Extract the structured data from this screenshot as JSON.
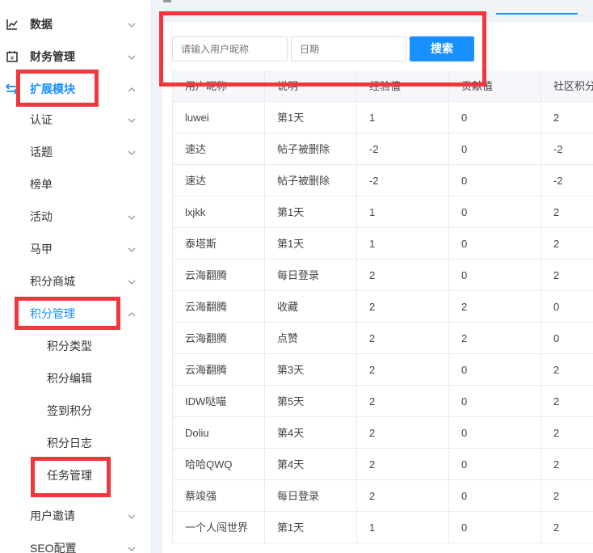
{
  "sidebar": {
    "items": [
      {
        "label": "数据",
        "level": "top",
        "icon": "line-chart-icon",
        "chevron": "down"
      },
      {
        "label": "财务管理",
        "level": "top",
        "icon": "wallet-icon",
        "chevron": "down"
      },
      {
        "label": "扩展模块",
        "level": "top",
        "icon": "extension-icon",
        "chevron": "up",
        "active": true
      },
      {
        "label": "认证",
        "level": "sub",
        "chevron": "down"
      },
      {
        "label": "话题",
        "level": "sub",
        "chevron": "down"
      },
      {
        "label": "榜单",
        "level": "sub"
      },
      {
        "label": "活动",
        "level": "sub",
        "chevron": "down"
      },
      {
        "label": "马甲",
        "level": "sub",
        "chevron": "down"
      },
      {
        "label": "积分商城",
        "level": "sub",
        "chevron": "down"
      },
      {
        "label": "积分管理",
        "level": "sub",
        "chevron": "up",
        "active": true
      },
      {
        "label": "积分类型",
        "level": "sub2"
      },
      {
        "label": "积分编辑",
        "level": "sub2"
      },
      {
        "label": "签到积分",
        "level": "sub2"
      },
      {
        "label": "积分日志",
        "level": "sub2"
      },
      {
        "label": "任务管理",
        "level": "sub2"
      },
      {
        "label": "用户邀请",
        "level": "sub",
        "chevron": "down"
      },
      {
        "label": "SEO配置",
        "level": "sub",
        "chevron": "down"
      }
    ]
  },
  "search": {
    "nickname_placeholder": "请输入用户昵称",
    "date_placeholder": "日期",
    "button_label": "搜索"
  },
  "table": {
    "headers": [
      "用户昵称",
      "说明",
      "经验值",
      "贡献值",
      "社区积分"
    ],
    "rows": [
      [
        "luwei",
        "第1天",
        "1",
        "0",
        "2"
      ],
      [
        "速达",
        "帖子被删除",
        "-2",
        "0",
        "-2"
      ],
      [
        "速达",
        "帖子被删除",
        "-2",
        "0",
        "-2"
      ],
      [
        "lxjkk",
        "第1天",
        "1",
        "0",
        "2"
      ],
      [
        "泰塔斯",
        "第1天",
        "1",
        "0",
        "2"
      ],
      [
        "云海翻腾",
        "每日登录",
        "2",
        "0",
        "2"
      ],
      [
        "云海翻腾",
        "收藏",
        "2",
        "2",
        "0"
      ],
      [
        "云海翻腾",
        "点赞",
        "2",
        "2",
        "0"
      ],
      [
        "云海翻腾",
        "第3天",
        "2",
        "0",
        "2"
      ],
      [
        "IDW哒喵",
        "第5天",
        "2",
        "0",
        "2"
      ],
      [
        "Doliu",
        "第4天",
        "2",
        "0",
        "2"
      ],
      [
        "哈哈QWQ",
        "第4天",
        "2",
        "0",
        "2"
      ],
      [
        "蔡竣强",
        "每日登录",
        "2",
        "0",
        "2"
      ],
      [
        "一个人闯世界",
        "第1天",
        "1",
        "0",
        "2"
      ]
    ]
  },
  "colors": {
    "accent": "#1890ff",
    "annotation": "#f0373d"
  }
}
